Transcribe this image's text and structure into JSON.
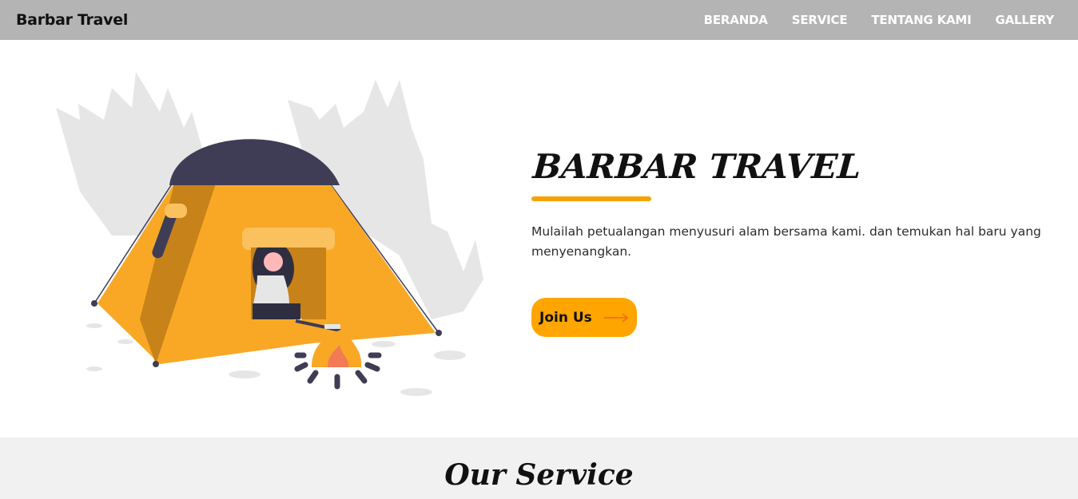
{
  "nav": {
    "brand": "Barbar Travel",
    "links": [
      "BERANDA",
      "SERVICE",
      "TENTANG KAMI",
      "GALLERY"
    ]
  },
  "hero": {
    "title": "BARBAR TRAVEL",
    "description": "Mulailah petualangan menyusuri alam bersama kami. dan temukan hal baru yang menyenangkan.",
    "button_label": "Join Us",
    "illustration": "camping-tent-illustration",
    "accent_color": "#ffa500",
    "underline_color": "#f5a300"
  },
  "services": {
    "title": "Our Service"
  },
  "colors": {
    "navbar_bg": "#b4b4b4",
    "section_bg": "#f1f1f1",
    "tent_orange": "#f9a826",
    "tent_dark": "#3f3d56"
  }
}
